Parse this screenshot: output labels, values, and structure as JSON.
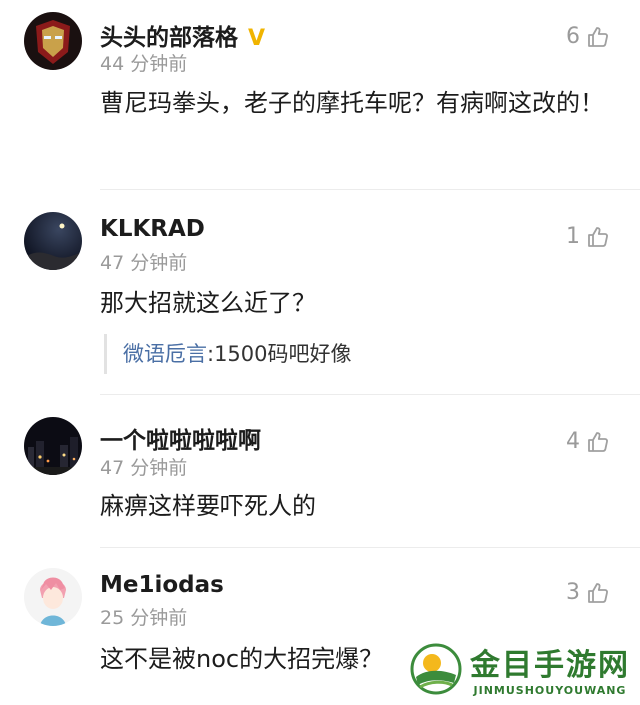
{
  "comments": [
    {
      "username": "头头的部落格",
      "badge": "V",
      "time": "44 分钟前",
      "likes": "6",
      "content": "曹尼玛拳头，老子的摩托车呢？有病啊这改的！",
      "avatar": "iron-man-avatar"
    },
    {
      "username": "KLKRAD",
      "time": "47 分钟前",
      "likes": "1",
      "content": "那大招就这么近了？",
      "reply": {
        "name": "微语卮言",
        "text": ":1500码吧好像"
      },
      "avatar": "night-sky-avatar"
    },
    {
      "username": "一个啦啦啦啦啊",
      "time": "47 分钟前",
      "likes": "4",
      "content": "麻痹这样要吓死人的",
      "avatar": "city-night-avatar"
    },
    {
      "username": "Me1iodas",
      "time": "25 分钟前",
      "likes": "3",
      "content": "这不是被noc的大招完爆？",
      "avatar": "anime-boy-avatar"
    }
  ],
  "watermark": {
    "cn": "金目手游网",
    "en": "JINMUSHOUYOUWANG"
  },
  "colors": {
    "badge": "#f0b400",
    "reply_name": "#4a6fa5",
    "watermark": "#2f7a2f"
  }
}
